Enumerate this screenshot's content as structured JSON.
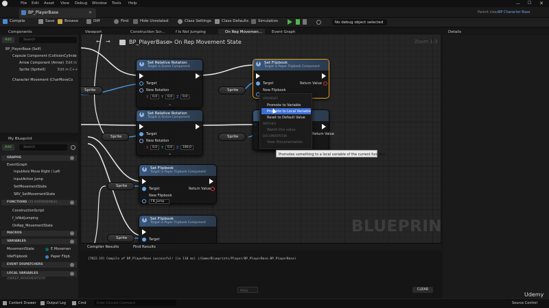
{
  "menu": [
    "File",
    "Edit",
    "Asset",
    "View",
    "Debug",
    "Window",
    "Tools",
    "Help"
  ],
  "document_tab": "BP_PlayerBase",
  "parent_class": {
    "label": "Parent class:",
    "value": "BP Character Base"
  },
  "toolbar": {
    "compile": "Compile",
    "save": "Save",
    "browse": "Browse",
    "diff": "Diff",
    "find": "Find",
    "hide_unrelated": "Hide Unrelated",
    "class_settings": "Class Settings",
    "class_defaults": "Class Defaults",
    "simulation": "Simulation",
    "debug_select": "No debug object selected"
  },
  "components": {
    "title": "Components",
    "add": "Add",
    "search_placeholder": "Search",
    "root": "BP_PlayerBase (Self)",
    "items": [
      "Capsule Component (CollisionCylinde",
      "Arrow Component (Arrow)",
      "Sprite (Sprite0)",
      "Character Movement (CharMoveCo"
    ],
    "edit_in": "Edit in",
    "edit_in_cpp": "Edit in C++"
  },
  "my_blueprint": {
    "title": "My Blueprint",
    "add": "Add",
    "search_placeholder": "Search",
    "graphs_label": "GRAPHS",
    "graph_items": [
      "EventGraph",
      "InputAxis Move Right / Left",
      "InputAction Jump",
      "SetMovementState",
      "SRV_SetMovementState"
    ],
    "functions_label": "FUNCTIONS",
    "functions_count": "(25 OVERRIDABLE)",
    "function_items": [
      "ConstructionScript",
      "f_IsNotJumping",
      "OnRep_MovementState"
    ],
    "macros_label": "MACROS",
    "variables_label": "VARIABLES",
    "variables": [
      {
        "name": "MovementState",
        "type": "E Movemen"
      },
      {
        "name": "IdleFlipbook",
        "type": "Paper Flipb"
      }
    ],
    "dispatchers_label": "EVENT DISPATCHERS",
    "local_label": "LOCAL VARIABLES",
    "local_suffix": "(ONREP_MOVEMENTSTAT"
  },
  "graph_tabs": [
    "Viewport",
    "Construction Scr...",
    "f Is Not Jumping",
    "On Rep Movemen...",
    "Event Graph"
  ],
  "details_title": "Details",
  "breadcrumb": {
    "root": "BP_PlayerBase",
    "sep": ">",
    "leaf": "On Rep Movement State",
    "zoom": "Zoom 1:3"
  },
  "nodes": {
    "set_rel_rot_1": {
      "title": "Set Relative Rotation",
      "subtitle": "Target is Scene Component",
      "target": "Target",
      "new_rot": "New Rotation",
      "x": "0,0",
      "y": "0,0",
      "z": "0,0"
    },
    "set_rel_rot_2": {
      "title": "Set Relative Rotation",
      "subtitle": "Target is Scene Component",
      "target": "Target",
      "new_rot": "New Rotation",
      "x": "0,0",
      "y": "0,0",
      "z": "180,0"
    },
    "set_flipbook_sel": {
      "title": "Set Flipbook",
      "subtitle": "Target is Paper Flipbook Component",
      "target": "Target",
      "new_flip": "New Flipbook",
      "ret": "Return Value"
    },
    "set_flipbook_3": {
      "title": "Set Flipbook",
      "subtitle": "Target is Paper Flipbook Component",
      "target": "Target",
      "new_flip": "New Flipbook",
      "ret": "Return Value",
      "dropdown": "FB_Jump"
    },
    "set_flipbook_4": {
      "title": "Set Flipbook",
      "subtitle": "Target is Paper Flipbook Component",
      "target": "Target"
    },
    "hidden_ret": "Return Value"
  },
  "var_nodes": [
    "Sprite",
    "Sprite",
    "Sprite",
    "Sprite",
    "Sprite",
    "Sprite"
  ],
  "context_menu": {
    "header1": "VARIABLES",
    "items": [
      "Promote to Variable",
      "Promote to Local Variable",
      "Reset to Default Value"
    ],
    "header2": "WATCHES",
    "watch": "Watch this value",
    "header3": "DOCUMENTATION",
    "doc": "View Documentation"
  },
  "tooltip": "Promotes something to a local variable of the current function",
  "watermark": "BLUEPRINT",
  "results_tabs": [
    "Compiler Results",
    "Find Results"
  ],
  "results_log": "[7822.19] Compile of BP_PlayerBase successful! [in 110 ms] (/Game/Blueprints/Player/BP_PlayerBase.BP_PlayerBase)",
  "results_page": "PAGE",
  "clear": "CLEAR",
  "statusbar": {
    "content_drawer": "Content Drawer",
    "output_log": "Output Log",
    "cmd": "Cmd",
    "console_placeholder": "Enter Console Command",
    "source_control": "Source Control"
  },
  "udemy": "Udemy"
}
